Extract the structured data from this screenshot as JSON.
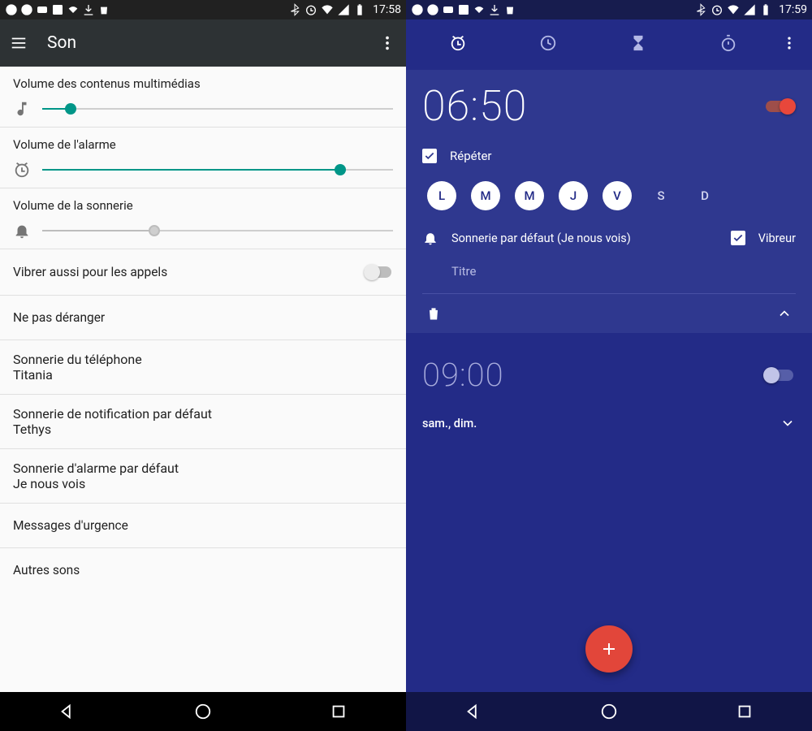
{
  "left": {
    "statusbar_time": "17:58",
    "title": "Son",
    "sliders": {
      "media": {
        "label": "Volume des contenus multimédias",
        "value": 8
      },
      "alarm": {
        "label": "Volume de l'alarme",
        "value": 85
      },
      "ring": {
        "label": "Volume de la sonnerie",
        "value": 32
      }
    },
    "rows": {
      "vibrate_calls": "Vibrer aussi pour les appels",
      "dnd": "Ne pas déranger",
      "phone_ringtone": {
        "label": "Sonnerie du téléphone",
        "value": "Titania"
      },
      "notif_ringtone": {
        "label": "Sonnerie de notification par défaut",
        "value": "Tethys"
      },
      "alarm_ringtone": {
        "label": "Sonnerie d'alarme par défaut",
        "value": "Je nous vois"
      },
      "emergency": "Messages d'urgence",
      "other": "Autres sons"
    }
  },
  "right": {
    "statusbar_time": "17:59",
    "alarm1": {
      "time": "06:50",
      "repeat_label": "Répéter",
      "days": {
        "L": true,
        "M1": true,
        "M2": true,
        "J": true,
        "V": true,
        "S": false,
        "D": false
      },
      "day_labels": [
        "L",
        "M",
        "M",
        "J",
        "V",
        "S",
        "D"
      ],
      "ringtone_label": "Sonnerie par défaut (Je nous vois)",
      "vibrate_label": "Vibreur",
      "title_placeholder": "Titre"
    },
    "alarm2": {
      "time": "09:00",
      "subtitle": "sam., dim."
    }
  }
}
